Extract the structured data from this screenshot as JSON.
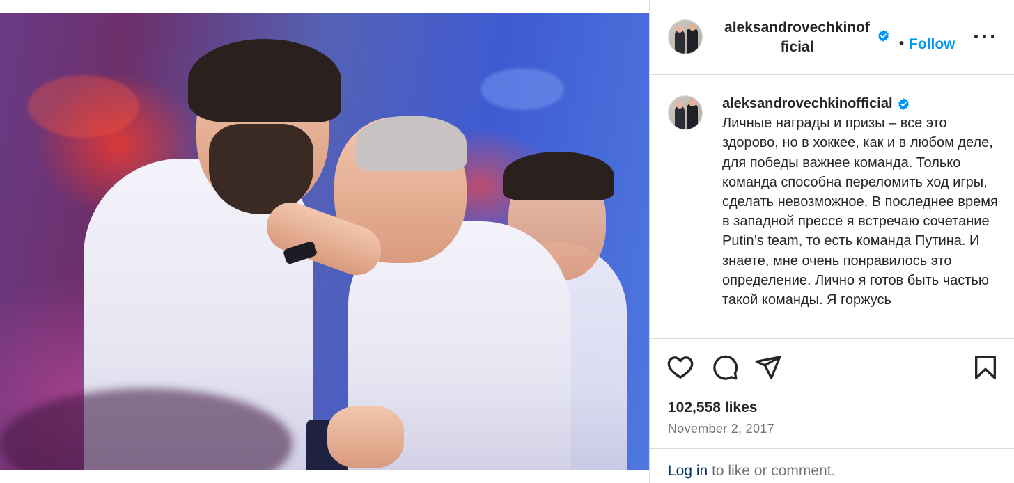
{
  "post": {
    "image_alt": "",
    "colors": {
      "accent": "#0095f6",
      "verified": "#0095f6",
      "text": "#262626",
      "muted": "#737373",
      "link": "#00376b"
    }
  },
  "header": {
    "avatar_icon": "profile-avatar",
    "username": "aleksandrovechkinofficial",
    "verified_icon": "verified-badge-icon",
    "separator": "•",
    "follow_label": "Follow",
    "more_icon": "more-options-icon"
  },
  "caption": {
    "username": "aleksandrovechkinofficial",
    "text": "Личные награды и призы – все это здорово, но в хоккее, как и в любом деле, для победы важнее команда. Только команда способна переломить ход игры, сделать невозможное. В последнее время в западной прессе я встречаю сочетание Putin’s team, то есть команда Путина. И знаете, мне очень понравилось это определение. Лично я готов быть частью такой команды. Я горжусь"
  },
  "actions": {
    "like_icon": "heart-icon",
    "comment_icon": "comment-icon",
    "share_icon": "share-icon",
    "save_icon": "bookmark-icon"
  },
  "stats": {
    "likes": "102,558 likes",
    "date": "November 2, 2017"
  },
  "footer": {
    "login_link": "Log in",
    "login_rest": " to like or comment."
  }
}
